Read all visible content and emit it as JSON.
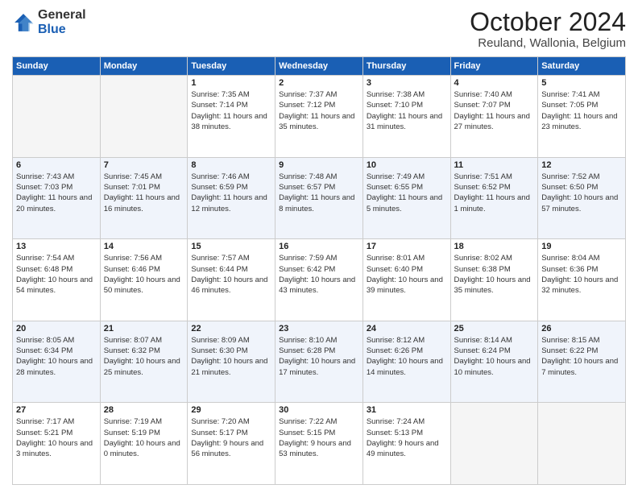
{
  "logo": {
    "general": "General",
    "blue": "Blue"
  },
  "header": {
    "title": "October 2024",
    "subtitle": "Reuland, Wallonia, Belgium"
  },
  "weekdays": [
    "Sunday",
    "Monday",
    "Tuesday",
    "Wednesday",
    "Thursday",
    "Friday",
    "Saturday"
  ],
  "weeks": [
    [
      {
        "day": "",
        "sunrise": "",
        "sunset": "",
        "daylight": ""
      },
      {
        "day": "",
        "sunrise": "",
        "sunset": "",
        "daylight": ""
      },
      {
        "day": "1",
        "sunrise": "Sunrise: 7:35 AM",
        "sunset": "Sunset: 7:14 PM",
        "daylight": "Daylight: 11 hours and 38 minutes."
      },
      {
        "day": "2",
        "sunrise": "Sunrise: 7:37 AM",
        "sunset": "Sunset: 7:12 PM",
        "daylight": "Daylight: 11 hours and 35 minutes."
      },
      {
        "day": "3",
        "sunrise": "Sunrise: 7:38 AM",
        "sunset": "Sunset: 7:10 PM",
        "daylight": "Daylight: 11 hours and 31 minutes."
      },
      {
        "day": "4",
        "sunrise": "Sunrise: 7:40 AM",
        "sunset": "Sunset: 7:07 PM",
        "daylight": "Daylight: 11 hours and 27 minutes."
      },
      {
        "day": "5",
        "sunrise": "Sunrise: 7:41 AM",
        "sunset": "Sunset: 7:05 PM",
        "daylight": "Daylight: 11 hours and 23 minutes."
      }
    ],
    [
      {
        "day": "6",
        "sunrise": "Sunrise: 7:43 AM",
        "sunset": "Sunset: 7:03 PM",
        "daylight": "Daylight: 11 hours and 20 minutes."
      },
      {
        "day": "7",
        "sunrise": "Sunrise: 7:45 AM",
        "sunset": "Sunset: 7:01 PM",
        "daylight": "Daylight: 11 hours and 16 minutes."
      },
      {
        "day": "8",
        "sunrise": "Sunrise: 7:46 AM",
        "sunset": "Sunset: 6:59 PM",
        "daylight": "Daylight: 11 hours and 12 minutes."
      },
      {
        "day": "9",
        "sunrise": "Sunrise: 7:48 AM",
        "sunset": "Sunset: 6:57 PM",
        "daylight": "Daylight: 11 hours and 8 minutes."
      },
      {
        "day": "10",
        "sunrise": "Sunrise: 7:49 AM",
        "sunset": "Sunset: 6:55 PM",
        "daylight": "Daylight: 11 hours and 5 minutes."
      },
      {
        "day": "11",
        "sunrise": "Sunrise: 7:51 AM",
        "sunset": "Sunset: 6:52 PM",
        "daylight": "Daylight: 11 hours and 1 minute."
      },
      {
        "day": "12",
        "sunrise": "Sunrise: 7:52 AM",
        "sunset": "Sunset: 6:50 PM",
        "daylight": "Daylight: 10 hours and 57 minutes."
      }
    ],
    [
      {
        "day": "13",
        "sunrise": "Sunrise: 7:54 AM",
        "sunset": "Sunset: 6:48 PM",
        "daylight": "Daylight: 10 hours and 54 minutes."
      },
      {
        "day": "14",
        "sunrise": "Sunrise: 7:56 AM",
        "sunset": "Sunset: 6:46 PM",
        "daylight": "Daylight: 10 hours and 50 minutes."
      },
      {
        "day": "15",
        "sunrise": "Sunrise: 7:57 AM",
        "sunset": "Sunset: 6:44 PM",
        "daylight": "Daylight: 10 hours and 46 minutes."
      },
      {
        "day": "16",
        "sunrise": "Sunrise: 7:59 AM",
        "sunset": "Sunset: 6:42 PM",
        "daylight": "Daylight: 10 hours and 43 minutes."
      },
      {
        "day": "17",
        "sunrise": "Sunrise: 8:01 AM",
        "sunset": "Sunset: 6:40 PM",
        "daylight": "Daylight: 10 hours and 39 minutes."
      },
      {
        "day": "18",
        "sunrise": "Sunrise: 8:02 AM",
        "sunset": "Sunset: 6:38 PM",
        "daylight": "Daylight: 10 hours and 35 minutes."
      },
      {
        "day": "19",
        "sunrise": "Sunrise: 8:04 AM",
        "sunset": "Sunset: 6:36 PM",
        "daylight": "Daylight: 10 hours and 32 minutes."
      }
    ],
    [
      {
        "day": "20",
        "sunrise": "Sunrise: 8:05 AM",
        "sunset": "Sunset: 6:34 PM",
        "daylight": "Daylight: 10 hours and 28 minutes."
      },
      {
        "day": "21",
        "sunrise": "Sunrise: 8:07 AM",
        "sunset": "Sunset: 6:32 PM",
        "daylight": "Daylight: 10 hours and 25 minutes."
      },
      {
        "day": "22",
        "sunrise": "Sunrise: 8:09 AM",
        "sunset": "Sunset: 6:30 PM",
        "daylight": "Daylight: 10 hours and 21 minutes."
      },
      {
        "day": "23",
        "sunrise": "Sunrise: 8:10 AM",
        "sunset": "Sunset: 6:28 PM",
        "daylight": "Daylight: 10 hours and 17 minutes."
      },
      {
        "day": "24",
        "sunrise": "Sunrise: 8:12 AM",
        "sunset": "Sunset: 6:26 PM",
        "daylight": "Daylight: 10 hours and 14 minutes."
      },
      {
        "day": "25",
        "sunrise": "Sunrise: 8:14 AM",
        "sunset": "Sunset: 6:24 PM",
        "daylight": "Daylight: 10 hours and 10 minutes."
      },
      {
        "day": "26",
        "sunrise": "Sunrise: 8:15 AM",
        "sunset": "Sunset: 6:22 PM",
        "daylight": "Daylight: 10 hours and 7 minutes."
      }
    ],
    [
      {
        "day": "27",
        "sunrise": "Sunrise: 7:17 AM",
        "sunset": "Sunset: 5:21 PM",
        "daylight": "Daylight: 10 hours and 3 minutes."
      },
      {
        "day": "28",
        "sunrise": "Sunrise: 7:19 AM",
        "sunset": "Sunset: 5:19 PM",
        "daylight": "Daylight: 10 hours and 0 minutes."
      },
      {
        "day": "29",
        "sunrise": "Sunrise: 7:20 AM",
        "sunset": "Sunset: 5:17 PM",
        "daylight": "Daylight: 9 hours and 56 minutes."
      },
      {
        "day": "30",
        "sunrise": "Sunrise: 7:22 AM",
        "sunset": "Sunset: 5:15 PM",
        "daylight": "Daylight: 9 hours and 53 minutes."
      },
      {
        "day": "31",
        "sunrise": "Sunrise: 7:24 AM",
        "sunset": "Sunset: 5:13 PM",
        "daylight": "Daylight: 9 hours and 49 minutes."
      },
      {
        "day": "",
        "sunrise": "",
        "sunset": "",
        "daylight": ""
      },
      {
        "day": "",
        "sunrise": "",
        "sunset": "",
        "daylight": ""
      }
    ]
  ]
}
